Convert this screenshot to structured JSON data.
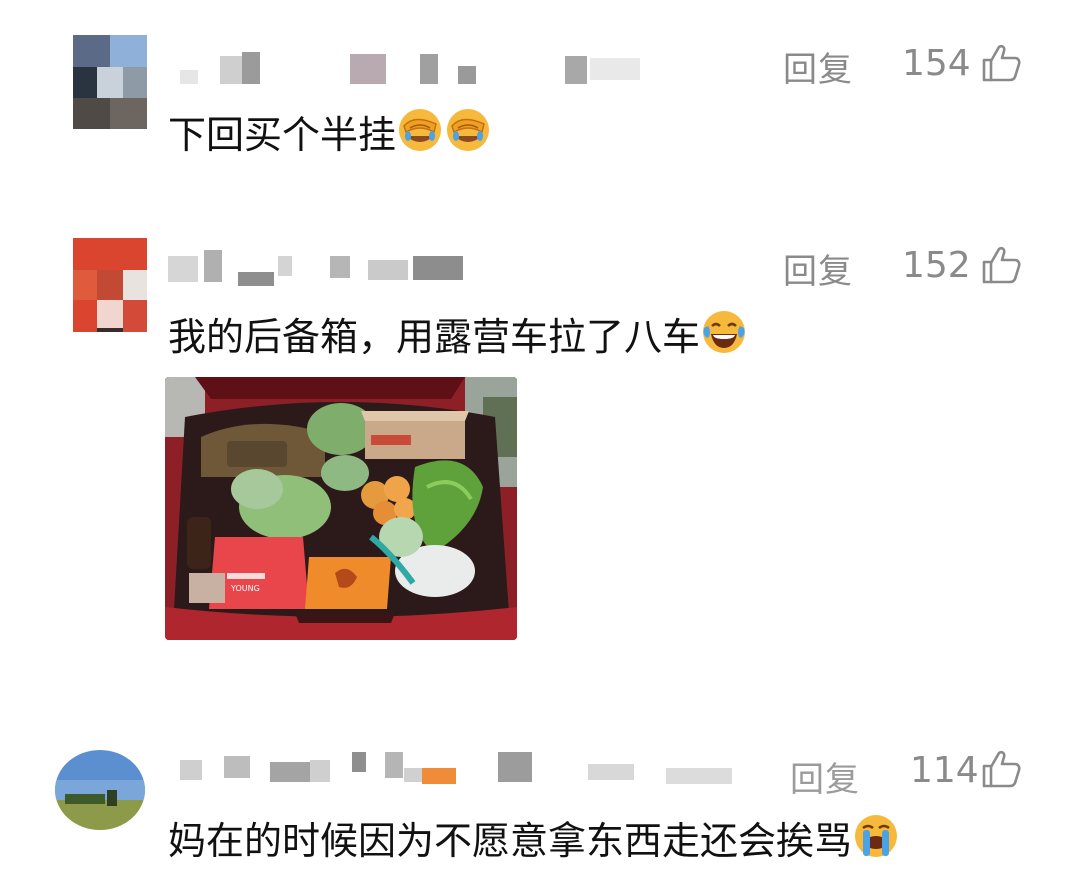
{
  "comments": [
    {
      "text": "下回买个半挂",
      "reply_label": "回复",
      "likes": "154",
      "emojis": [
        "facepalm-emoji",
        "facepalm-emoji"
      ]
    },
    {
      "text": "我的后备箱，用露营车拉了八车",
      "reply_label": "回复",
      "likes": "152",
      "emojis": [
        "tears-of-joy-emoji"
      ],
      "photo": {
        "subject": "car-trunk-with-groceries",
        "bag_text": "YOUNG"
      }
    },
    {
      "text": "妈在的时候因为不愿意拿东西走还会挨骂",
      "reply_label": "回复",
      "likes": "114",
      "emojis": [
        "loudly-crying-emoji"
      ]
    }
  ],
  "colors": {
    "meta_gray": "#8a8a8a",
    "text": "#111111",
    "emoji_yellow": "#f6b93b"
  }
}
